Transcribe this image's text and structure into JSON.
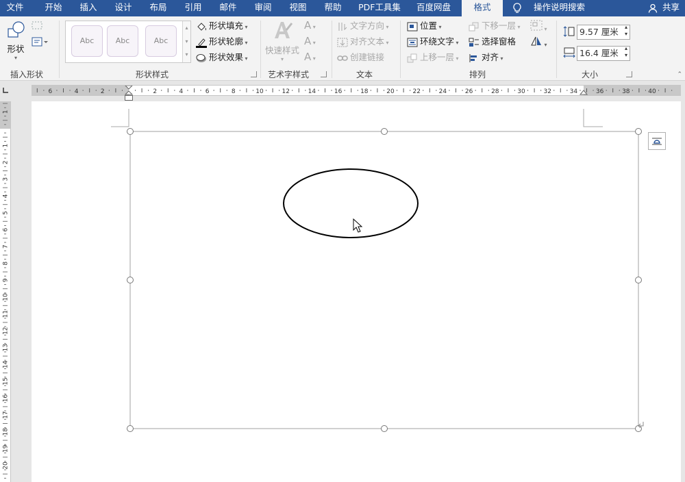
{
  "tabs": [
    {
      "label": "文件"
    },
    {
      "label": "开始"
    },
    {
      "label": "插入"
    },
    {
      "label": "设计"
    },
    {
      "label": "布局"
    },
    {
      "label": "引用"
    },
    {
      "label": "邮件"
    },
    {
      "label": "审阅"
    },
    {
      "label": "视图"
    },
    {
      "label": "帮助"
    },
    {
      "label": "PDF工具集"
    },
    {
      "label": "百度网盘"
    },
    {
      "label": "格式"
    }
  ],
  "tell_me": "操作说明搜索",
  "share": "共享",
  "ribbon": {
    "insert_shapes": {
      "shapes_label": "形状",
      "group_label": "插入形状"
    },
    "shape_styles": {
      "gallery_items": [
        "Abc",
        "Abc",
        "Abc"
      ],
      "fill": "形状填充",
      "outline": "形状轮廓",
      "effects": "形状效果",
      "group_label": "形状样式"
    },
    "wordart": {
      "quick_styles": "快速样式",
      "group_label": "艺术字样式"
    },
    "text": {
      "direction": "文字方向",
      "align": "对齐文本",
      "link": "创建链接",
      "group_label": "文本"
    },
    "arrange": {
      "position": "位置",
      "wrap_text": "环绕文字",
      "bring_forward": "上移一层",
      "send_backward": "下移一层",
      "selection_pane": "选择窗格",
      "align": "对齐",
      "group_label": "排列"
    },
    "size": {
      "height": "9.57 厘米",
      "width": "16.4 厘米",
      "group_label": "大小"
    }
  },
  "ruler": {
    "horizontal_left": [
      "6",
      "4",
      "2"
    ],
    "horizontal_right": [
      "2",
      "4",
      "6",
      "8",
      "10",
      "12",
      "14",
      "16",
      "18",
      "20",
      "22",
      "24",
      "26",
      "28",
      "30",
      "32",
      "34",
      "36",
      "38",
      "40"
    ],
    "vertical": [
      "1",
      "1",
      "2",
      "3",
      "4",
      "5",
      "6",
      "7",
      "8",
      "9",
      "10",
      "11",
      "12",
      "13",
      "14",
      "15",
      "16",
      "17",
      "18",
      "19",
      "20"
    ]
  }
}
